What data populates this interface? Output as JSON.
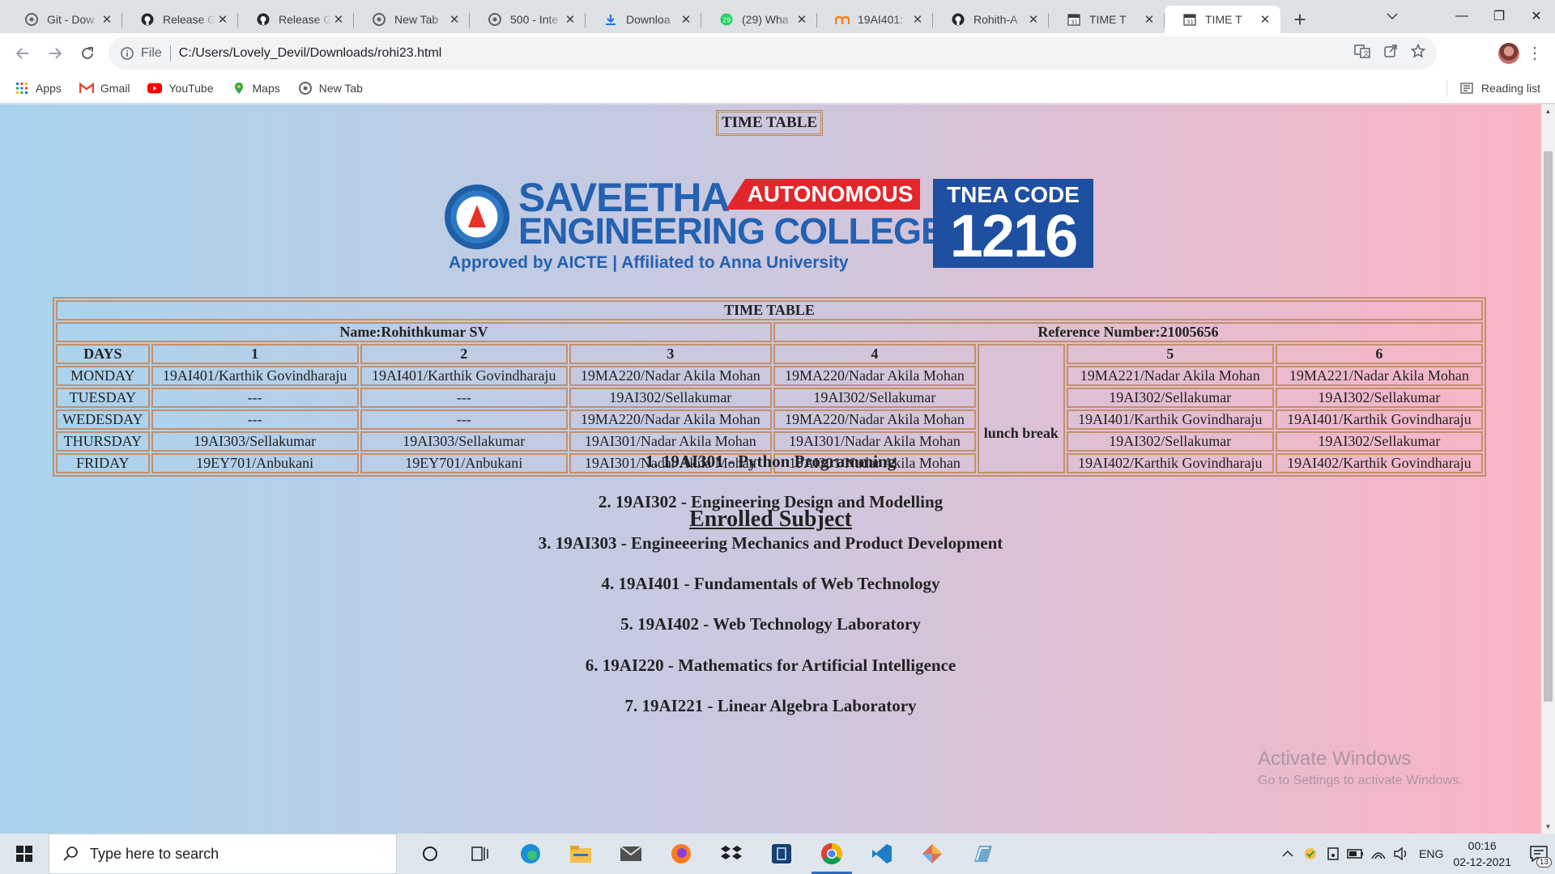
{
  "browser": {
    "tabs": [
      {
        "title": "Git - Dow",
        "icon": "chrome-icon"
      },
      {
        "title": "Release G",
        "icon": "github-icon"
      },
      {
        "title": "Release G",
        "icon": "github-icon"
      },
      {
        "title": "New Tab",
        "icon": "chrome-icon"
      },
      {
        "title": "500 - Inte",
        "icon": "chrome-icon"
      },
      {
        "title": "Downloa",
        "icon": "download-icon"
      },
      {
        "title": "(29) Wha",
        "icon": "whatsapp-icon"
      },
      {
        "title": "19AI401:",
        "icon": "moodle-icon"
      },
      {
        "title": "Rohith-A",
        "icon": "github-icon"
      },
      {
        "title": "TIME T",
        "icon": "calendar-icon"
      },
      {
        "title": "TIME T",
        "icon": "calendar-icon"
      }
    ],
    "active_tab": 10,
    "address": {
      "scheme_label": "File",
      "url": "C:/Users/Lovely_Devil/Downloads/rohi23.html"
    },
    "bookmarks": [
      {
        "label": "Apps",
        "icon": "apps-grid-icon"
      },
      {
        "label": "Gmail",
        "icon": "gmail-icon"
      },
      {
        "label": "YouTube",
        "icon": "youtube-icon"
      },
      {
        "label": "Maps",
        "icon": "maps-icon"
      },
      {
        "label": "New Tab",
        "icon": "chrome-icon"
      }
    ],
    "reading_list_label": "Reading list"
  },
  "page": {
    "caption": "TIME TABLE",
    "logo": {
      "name_line1": "SAVEETHA",
      "badge": "AUTONOMOUS",
      "name_line2": "ENGINEERING COLLEGE",
      "subtitle": "Approved by AICTE  |  Affiliated to Anna University",
      "code_label": "TNEA CODE",
      "code_value": "1216"
    },
    "table": {
      "title": "TIME TABLE",
      "name": "Name:Rohithkumar SV",
      "reference": "Reference Number:21005656",
      "headers": [
        "DAYS",
        "1",
        "2",
        "3",
        "4",
        "5",
        "6"
      ],
      "lunch_label": "lunch break",
      "rows": [
        {
          "day": "MONDAY",
          "p1": "19AI401/Karthik Govindharaju",
          "p2": "19AI401/Karthik Govindharaju",
          "p3": "19MA220/Nadar Akila Mohan",
          "p4": "19MA220/Nadar Akila Mohan",
          "p5": "19MA221/Nadar Akila Mohan",
          "p6": "19MA221/Nadar Akila Mohan"
        },
        {
          "day": "TUESDAY",
          "p1": "---",
          "p2": "---",
          "p3": "19AI302/Sellakumar",
          "p4": "19AI302/Sellakumar",
          "p5": "19AI302/Sellakumar",
          "p6": "19AI302/Sellakumar"
        },
        {
          "day": "WEDESDAY",
          "p1": "---",
          "p2": "---",
          "p3": "19MA220/Nadar Akila Mohan",
          "p4": "19MA220/Nadar Akila Mohan",
          "p5": "19AI401/Karthik Govindharaju",
          "p6": "19AI401/Karthik Govindharaju"
        },
        {
          "day": "THURSDAY",
          "p1": "19AI303/Sellakumar",
          "p2": "19AI303/Sellakumar",
          "p3": "19AI301/Nadar Akila Mohan",
          "p4": "19AI301/Nadar Akila Mohan",
          "p5": "19AI302/Sellakumar",
          "p6": "19AI302/Sellakumar"
        },
        {
          "day": "FRIDAY",
          "p1": "19EY701/Anbukani",
          "p2": "19EY701/Anbukani",
          "p3": "19AI301/Nadar Akila Mohan",
          "p4": "19AI301/Nadar Akila Mohan",
          "p5": "19AI402/Karthik Govindharaju",
          "p6": "19AI402/Karthik Govindharaju"
        }
      ]
    },
    "enrolled_heading": "Enrolled Subject",
    "subjects": [
      "1. 19AI301 - Python Programming",
      "2. 19AI302 - Engineering Design and Modelling",
      "3. 19AI303 - Engineeering Mechanics and Product Development",
      "4. 19AI401 - Fundamentals of Web Technology",
      "5. 19AI402 - Web Technology Laboratory",
      "6. 19AI220 - Mathematics for Artificial Intelligence",
      "7. 19AI221 - Linear Algebra Laboratory"
    ],
    "watermark": {
      "line1": "Activate Windows",
      "line2": "Go to Settings to activate Windows."
    }
  },
  "taskbar": {
    "search_placeholder": "Type here to search",
    "lang": "ENG",
    "time": "00:16",
    "date": "02-12-2021",
    "notification_count": "13"
  }
}
